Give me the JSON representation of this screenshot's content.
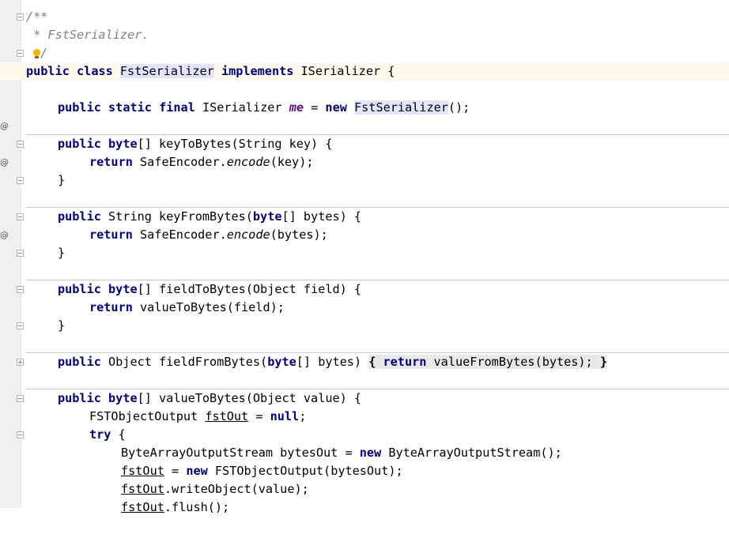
{
  "colors": {
    "keyword": "#000080",
    "comment": "#808080",
    "field": "#660e7a",
    "current_line": "#fcfaed",
    "identifier_highlight": "#e4e4ff"
  },
  "gutter": {
    "override_marker": "@"
  },
  "code": {
    "comment_open": "/**",
    "comment_desc": " * FstSerializer.",
    "comment_close": "/",
    "class_public": "public",
    "class_class": "class",
    "class_name": "FstSerializer",
    "class_implements": "implements",
    "class_iface": "ISerializer {",
    "me_public": "public",
    "me_static": "static",
    "me_final": "final",
    "me_type": "ISerializer",
    "me_name": "me",
    "me_eq": " = ",
    "me_new": "new",
    "me_ctor": "FstSerializer",
    "me_end": "();",
    "k2b_public": "public",
    "k2b_byte": "byte",
    "k2b_sig": "[] keyToBytes(String key) {",
    "k2b_return": "return",
    "k2b_call_a": " SafeEncoder.",
    "k2b_call_m": "encode",
    "k2b_call_b": "(key);",
    "close_brace": "}",
    "kfb_public": "public",
    "kfb_sig_a": " String keyFromBytes(",
    "kfb_byte": "byte",
    "kfb_sig_b": "[] bytes) {",
    "kfb_return": "return",
    "kfb_call_a": " SafeEncoder.",
    "kfb_call_m": "encode",
    "kfb_call_b": "(bytes);",
    "f2b_public": "public",
    "f2b_byte": "byte",
    "f2b_sig": "[] fieldToBytes(Object field) {",
    "f2b_return": "return",
    "f2b_call": " valueToBytes(field);",
    "ffb_public": "public",
    "ffb_sig_a": " Object fieldFromBytes(",
    "ffb_byte": "byte",
    "ffb_sig_b": "[] bytes) ",
    "ffb_open": "{",
    "ffb_return": "return",
    "ffb_call": " valueFromBytes(bytes);",
    "ffb_close": "}",
    "v2b_public": "public",
    "v2b_byte": "byte",
    "v2b_sig": "[] valueToBytes(Object value) {",
    "decl_type": "FSTObjectOutput ",
    "decl_var": "fstOut",
    "decl_eq": " = ",
    "decl_null": "null",
    "decl_end": ";",
    "try_kw": "try",
    "try_brace": " {",
    "baos_a": "ByteArrayOutputStream bytesOut = ",
    "baos_new": "new",
    "baos_b": " ByteArrayOutputStream();",
    "assign_var": "fstOut",
    "assign_eq": " = ",
    "assign_new": "new",
    "assign_b": " FSTObjectOutput(bytesOut);",
    "write_var": "fstOut",
    "write_call": ".writeObject(value);",
    "flush_var": "fstOut",
    "flush_call": ".flush();"
  }
}
